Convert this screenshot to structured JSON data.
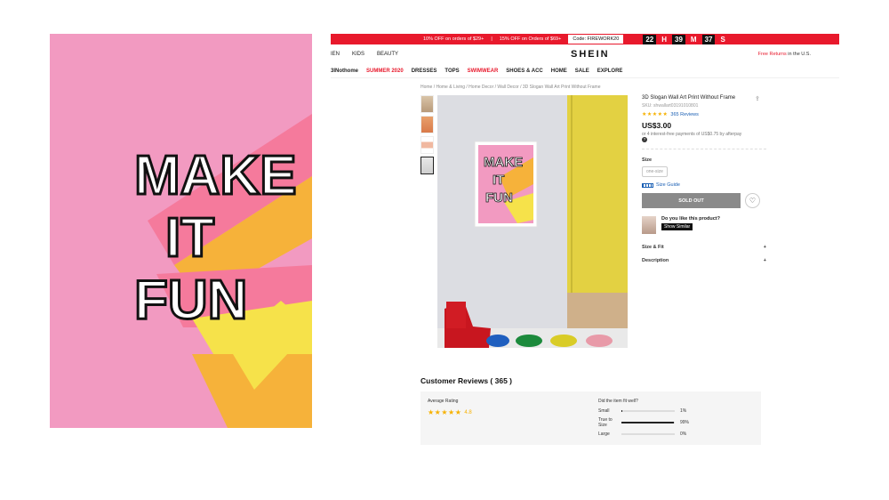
{
  "promo": {
    "offer1": "10% OFF on orders of $29+",
    "offer2": "15% OFF on Orders of $69+",
    "code": "Code: FIREWORK20",
    "countdown": [
      {
        "num": "22",
        "unit": "H"
      },
      {
        "num": "39",
        "unit": "M"
      },
      {
        "num": "37",
        "unit": "S"
      }
    ]
  },
  "header": {
    "nav_left": [
      "IEN",
      "KIDS",
      "BEAUTY"
    ],
    "logo": "SHEIN",
    "returns_red": "Free Returns",
    "returns_rest": " in the U.S."
  },
  "catnav": [
    "3INothome",
    "SUMMER 2020",
    "DRESSES",
    "TOPS",
    "SWIMWEAR",
    "SHOES & ACC",
    "HOME",
    "SALE",
    "EXPLORE"
  ],
  "catnav_red": [
    false,
    true,
    false,
    false,
    true,
    false,
    false,
    false,
    false
  ],
  "breadcrumb": "Home /  Home & Living /  Home Decor /  Wall Decor /  3D Slogan Wall Art Print Without Frame",
  "poster": {
    "lines": [
      "MAKE",
      "IT",
      "FUN"
    ]
  },
  "product": {
    "title": "3D Slogan Wall Art Print Without Frame",
    "sku": "SKU: shwallart03191010801",
    "stars": "★★★★★",
    "reviews_link": "365 Reviews",
    "price": "US$3.00",
    "afterpay": "or 4 interest-free payments of US$0.75 by afterpay",
    "help": "?",
    "size_label": "Size",
    "size_option": "one-size",
    "size_guide": "Size Guide",
    "soldout": "SOLD OUT",
    "wish_icon": "♡",
    "similar_q": "Do you like this product?",
    "similar_btn": "Show Similar",
    "size_fit": "Size & Fit",
    "description": "Description",
    "plus": "+",
    "share_icon": "⇪"
  },
  "reviews": {
    "heading": "Customer Reviews ( 365 )",
    "avg_label": "Average Rating",
    "avg_stars": "★★★★★",
    "avg_score": "4.8",
    "fit_q": "Did the item fit well?",
    "fit": [
      {
        "label": "Small",
        "pct": "1%",
        "fraction": 0.01
      },
      {
        "label": "True to Size",
        "pct": "99%",
        "fraction": 0.99
      },
      {
        "label": "Large",
        "pct": "0%",
        "fraction": 0.0
      }
    ]
  },
  "colors": {
    "accent_red": "#e8192c",
    "poster_pink": "#f29ac1",
    "star_gold": "#f6b100"
  }
}
